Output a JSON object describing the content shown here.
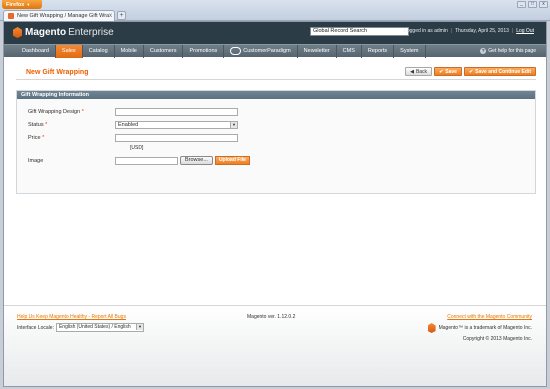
{
  "browser": {
    "menu_label": "Firefox",
    "tab_title": "New Gift Wrapping / Manage Gift Wrap...",
    "tab_close": "x",
    "new_tab": "+",
    "window_buttons": [
      "_",
      "□",
      "x"
    ]
  },
  "header": {
    "logo_bold": "Magento",
    "logo_light": "Enterprise",
    "search_value": "Global Record Search",
    "logged_in": "Logged in as admin",
    "date": "Thursday, April 25, 2013",
    "logout": "Log Out"
  },
  "nav": {
    "items": [
      "Dashboard",
      "Sales",
      "Catalog",
      "Mobile",
      "Customers",
      "Promotions",
      "CustomerParadigm",
      "Newsletter",
      "CMS",
      "Reports",
      "System"
    ],
    "active": "Sales",
    "help": "Get help for this page"
  },
  "content": {
    "title": "New Gift Wrapping",
    "buttons": {
      "back": "Back",
      "save": "Save",
      "save_continue": "Save and Continue Edit"
    }
  },
  "form": {
    "section_title": "Gift Wrapping Information",
    "design_label": "Gift Wrapping Design",
    "design_value": "",
    "status_label": "Status",
    "status_value": "Enabled",
    "price_label": "Price",
    "price_value": "",
    "price_note": "[USD]",
    "image_label": "Image",
    "browse": "Browse...",
    "upload": "Upload File",
    "required_mark": "*"
  },
  "footer": {
    "help_link": "Help Us Keep Magento Healthy - Report All Bugs",
    "locale_label": "Interface Locale:",
    "locale_value": "English (United States) / English",
    "version": "Magento ver. 1.12.0.2",
    "connect": "Connect with the Magento Community",
    "trademark": "Magento™ is a trademark of Magento Inc.",
    "copyright": "Copyright © 2013 Magento Inc."
  },
  "colors": {
    "accent": "#eb5e00",
    "header_bg": "#2c3c47",
    "nav_bg": "#5f6e78"
  }
}
